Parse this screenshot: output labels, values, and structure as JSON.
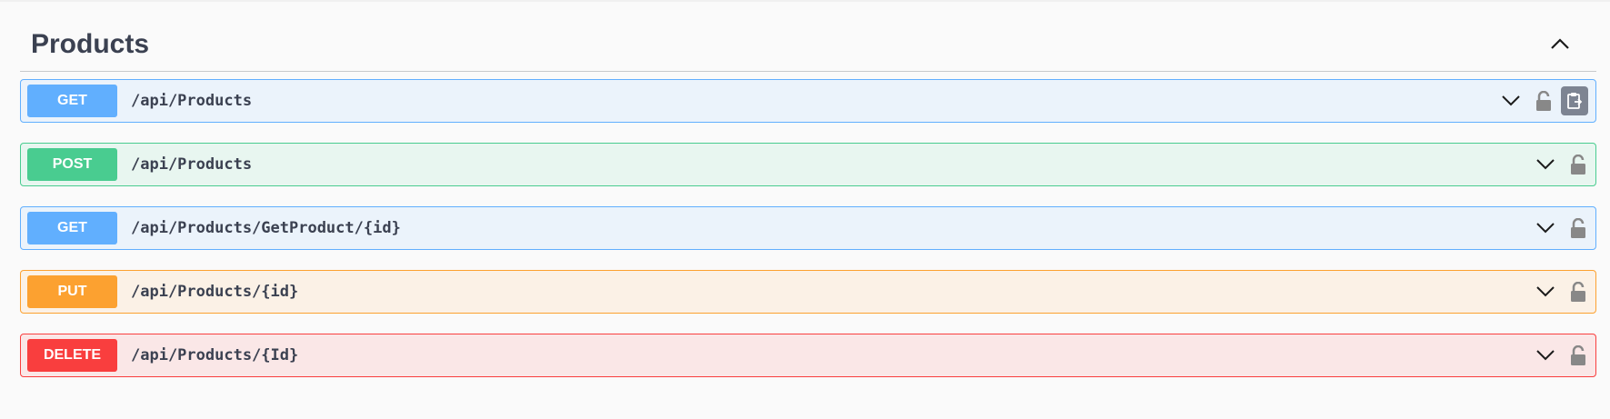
{
  "section": {
    "title": "Products",
    "collapse_icon": "chevron-up-icon"
  },
  "operations": [
    {
      "method": "GET",
      "path": "/api/Products",
      "color": "#61affe",
      "has_copy": true
    },
    {
      "method": "POST",
      "path": "/api/Products",
      "color": "#49cc90",
      "has_copy": false
    },
    {
      "method": "GET",
      "path": "/api/Products/GetProduct/{id}",
      "color": "#61affe",
      "has_copy": false
    },
    {
      "method": "PUT",
      "path": "/api/Products/{id}",
      "color": "#fca130",
      "has_copy": false
    },
    {
      "method": "DELETE",
      "path": "/api/Products/{Id}",
      "color": "#f93e3e",
      "has_copy": false
    }
  ],
  "icons": {
    "expand": "chevron-down-icon",
    "lock": "lock-icon",
    "copy": "copy-to-clipboard-icon"
  },
  "colors": {
    "title": "#3b4151",
    "get": "#61affe",
    "post": "#49cc90",
    "put": "#fca130",
    "delete": "#f93e3e"
  }
}
